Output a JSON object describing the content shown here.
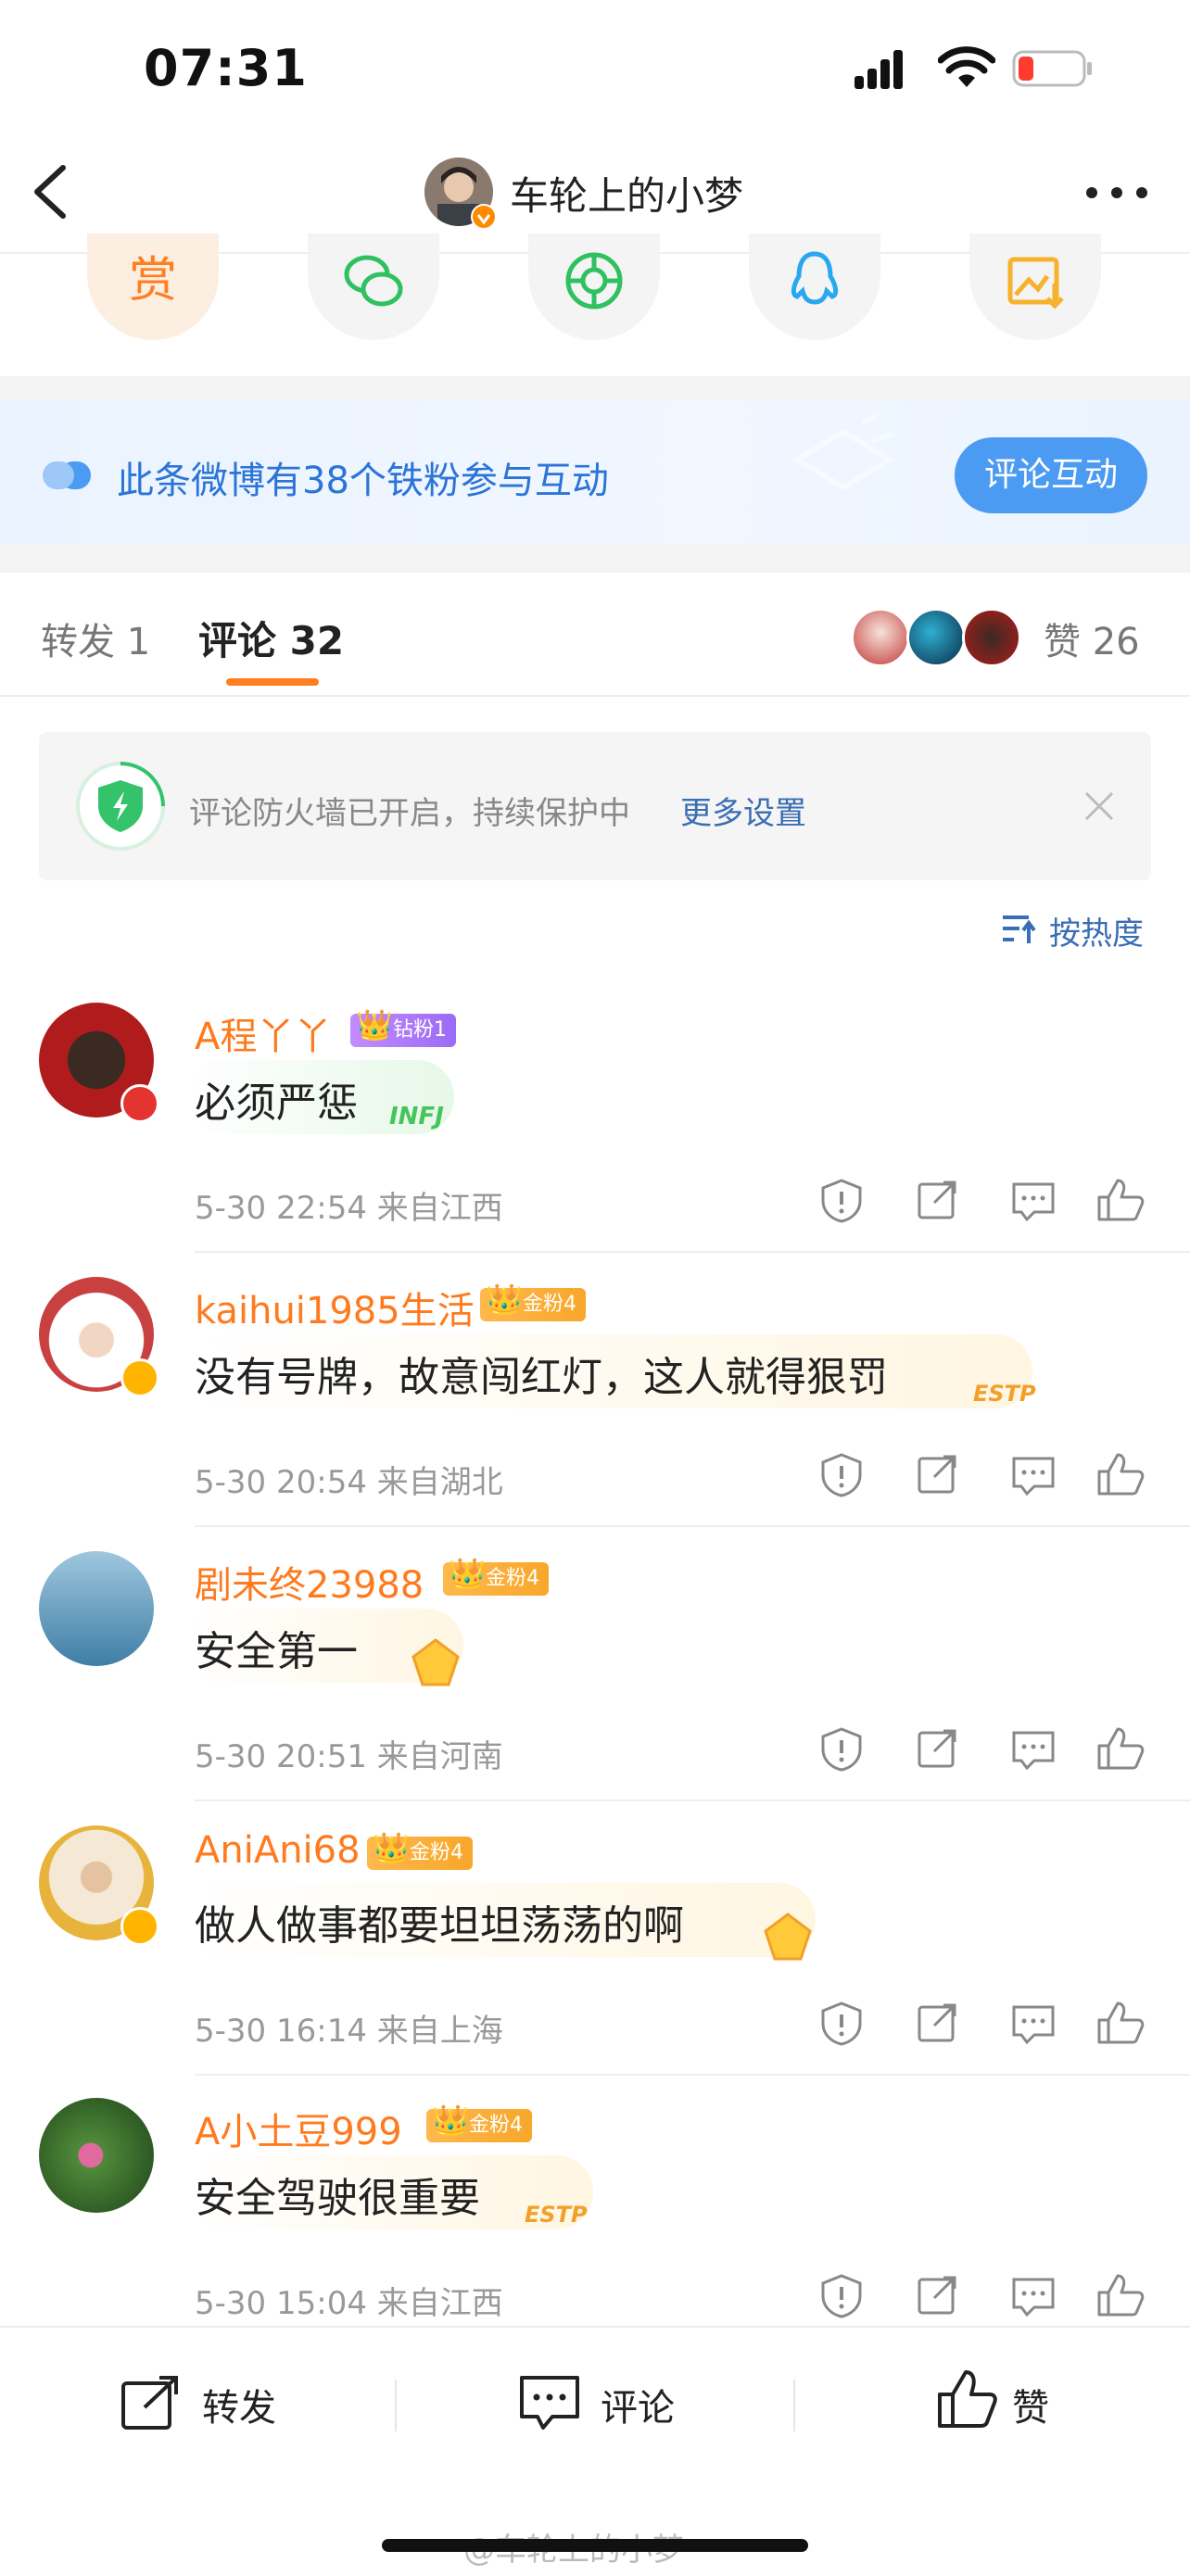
{
  "status_bar": {
    "time": "07:31"
  },
  "nav": {
    "title": "车轮上的小梦"
  },
  "banner": {
    "text": "此条微博有38个铁粉参与互动",
    "button": "评论互动"
  },
  "tabs": {
    "repost": "转发 1",
    "comment": "评论 32",
    "likes": "赞 26"
  },
  "firewall": {
    "text": "评论防火墙已开启，持续保护中",
    "link": "更多设置"
  },
  "sort": {
    "label": "按热度"
  },
  "comments": [
    {
      "name": "A程丫丫",
      "fan": "钻粉1",
      "text": "必须严惩",
      "meta": "5-30 22:54  来自江西",
      "deco": "INFJ"
    },
    {
      "name": "kaihui1985生活",
      "fan": "金粉4",
      "text": "没有号牌，故意闯红灯，这人就得狠罚",
      "meta": "5-30 20:54  来自湖北",
      "deco": "ESTP"
    },
    {
      "name": "剧未终23988",
      "fan": "金粉4",
      "text": "安全第一",
      "meta": "5-30 20:51  来自河南",
      "deco": ""
    },
    {
      "name": "AniAni68",
      "fan": "金粉4",
      "text": "做人做事都要坦坦荡荡的啊",
      "meta": "5-30 16:14  来自上海",
      "deco": ""
    },
    {
      "name": "A小土豆999",
      "fan": "金粉4",
      "text": "安全驾驶很重要",
      "meta": "5-30 15:04  来自江西",
      "deco": "ESTP"
    }
  ],
  "bottom_bar": {
    "repost": "转发",
    "comment": "评论",
    "like": "赞"
  },
  "watermark": "@车轮上的小梦",
  "colors": {
    "accent": "#ff7e1f",
    "link": "#3a6db3",
    "name": "#ff7a1e",
    "banner_button": "#4b9bf2"
  }
}
